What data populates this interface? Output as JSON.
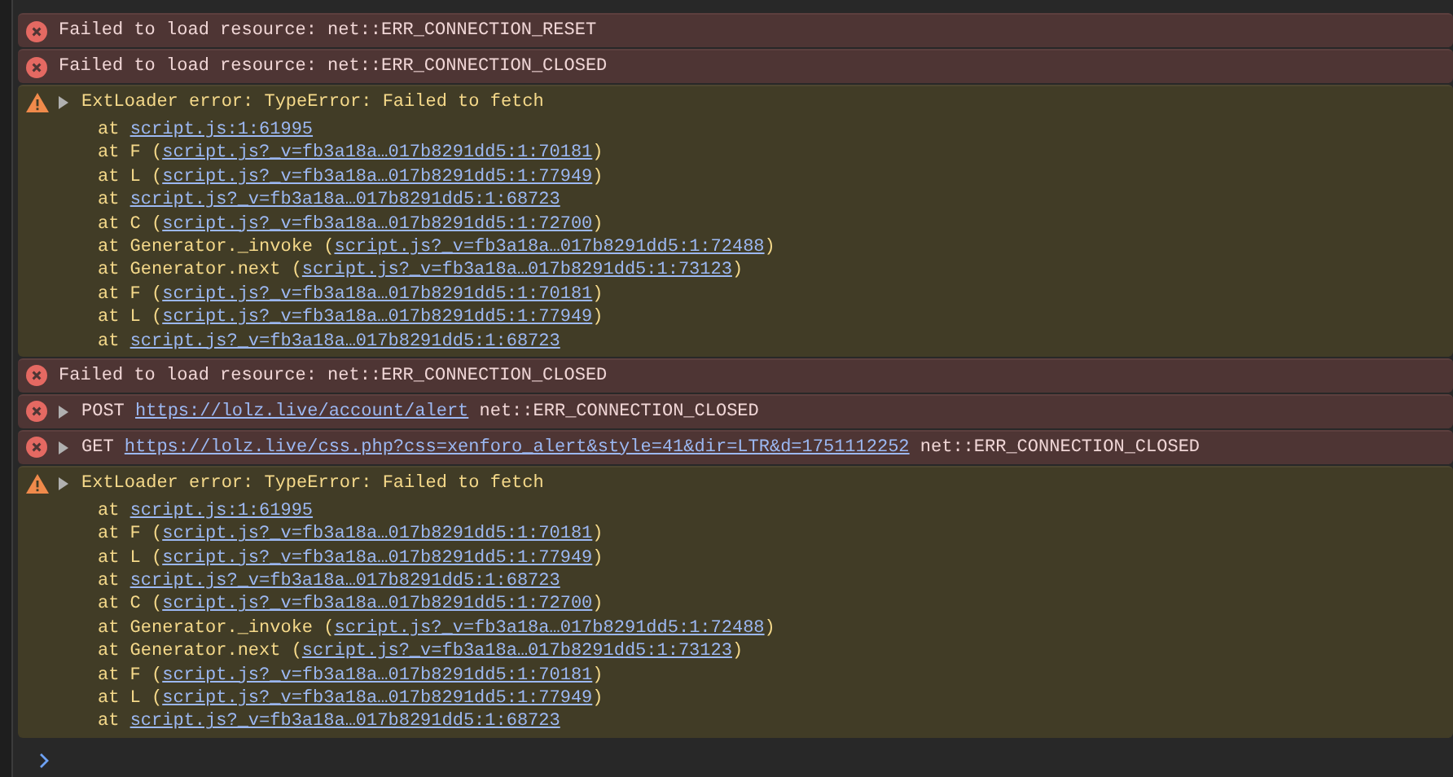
{
  "messages": [
    {
      "kind": "error",
      "expandable": false,
      "segments": [
        {
          "text": "Failed to load resource: net::ERR_CONNECTION_RESET",
          "link": false
        }
      ]
    },
    {
      "kind": "error",
      "expandable": false,
      "segments": [
        {
          "text": "Failed to load resource: net::ERR_CONNECTION_CLOSED",
          "link": false
        }
      ]
    },
    {
      "kind": "warning",
      "expandable": true,
      "segments": [
        {
          "text": "ExtLoader error: TypeError: Failed to fetch",
          "link": false
        }
      ],
      "stack": [
        {
          "prefix": "at ",
          "link": "script.js:1:61995"
        },
        {
          "prefix": "at F (",
          "link": "script.js?_v=fb3a18a…017b8291dd5:1:70181",
          "suffix": ")"
        },
        {
          "prefix": "at L (",
          "link": "script.js?_v=fb3a18a…017b8291dd5:1:77949",
          "suffix": ")"
        },
        {
          "prefix": "at ",
          "link": "script.js?_v=fb3a18a…017b8291dd5:1:68723"
        },
        {
          "prefix": "at C (",
          "link": "script.js?_v=fb3a18a…017b8291dd5:1:72700",
          "suffix": ")"
        },
        {
          "prefix": "at Generator._invoke (",
          "link": "script.js?_v=fb3a18a…017b8291dd5:1:72488",
          "suffix": ")"
        },
        {
          "prefix": "at Generator.next (",
          "link": "script.js?_v=fb3a18a…017b8291dd5:1:73123",
          "suffix": ")"
        },
        {
          "prefix": "at F (",
          "link": "script.js?_v=fb3a18a…017b8291dd5:1:70181",
          "suffix": ")"
        },
        {
          "prefix": "at L (",
          "link": "script.js?_v=fb3a18a…017b8291dd5:1:77949",
          "suffix": ")"
        },
        {
          "prefix": "at ",
          "link": "script.js?_v=fb3a18a…017b8291dd5:1:68723"
        }
      ]
    },
    {
      "kind": "error",
      "expandable": false,
      "segments": [
        {
          "text": "Failed to load resource: net::ERR_CONNECTION_CLOSED",
          "link": false
        }
      ]
    },
    {
      "kind": "error",
      "expandable": true,
      "segments": [
        {
          "text": "POST ",
          "link": false
        },
        {
          "text": "https://lolz.live/account/alert",
          "link": true
        },
        {
          "text": " net::ERR_CONNECTION_CLOSED",
          "link": false
        }
      ]
    },
    {
      "kind": "error",
      "expandable": true,
      "segments": [
        {
          "text": "GET ",
          "link": false
        },
        {
          "text": "https://lolz.live/css.php?css=xenforo_alert&style=41&dir=LTR&d=1751112252",
          "link": true
        },
        {
          "text": " net::ERR_CONNECTION_CLOSED",
          "link": false
        }
      ]
    },
    {
      "kind": "warning",
      "expandable": true,
      "segments": [
        {
          "text": "ExtLoader error: TypeError: Failed to fetch",
          "link": false
        }
      ],
      "stack": [
        {
          "prefix": "at ",
          "link": "script.js:1:61995"
        },
        {
          "prefix": "at F (",
          "link": "script.js?_v=fb3a18a…017b8291dd5:1:70181",
          "suffix": ")"
        },
        {
          "prefix": "at L (",
          "link": "script.js?_v=fb3a18a…017b8291dd5:1:77949",
          "suffix": ")"
        },
        {
          "prefix": "at ",
          "link": "script.js?_v=fb3a18a…017b8291dd5:1:68723"
        },
        {
          "prefix": "at C (",
          "link": "script.js?_v=fb3a18a…017b8291dd5:1:72700",
          "suffix": ")"
        },
        {
          "prefix": "at Generator._invoke (",
          "link": "script.js?_v=fb3a18a…017b8291dd5:1:72488",
          "suffix": ")"
        },
        {
          "prefix": "at Generator.next (",
          "link": "script.js?_v=fb3a18a…017b8291dd5:1:73123",
          "suffix": ")"
        },
        {
          "prefix": "at F (",
          "link": "script.js?_v=fb3a18a…017b8291dd5:1:70181",
          "suffix": ")"
        },
        {
          "prefix": "at L (",
          "link": "script.js?_v=fb3a18a…017b8291dd5:1:77949",
          "suffix": ")"
        },
        {
          "prefix": "at ",
          "link": "script.js?_v=fb3a18a…017b8291dd5:1:68723"
        }
      ]
    }
  ]
}
